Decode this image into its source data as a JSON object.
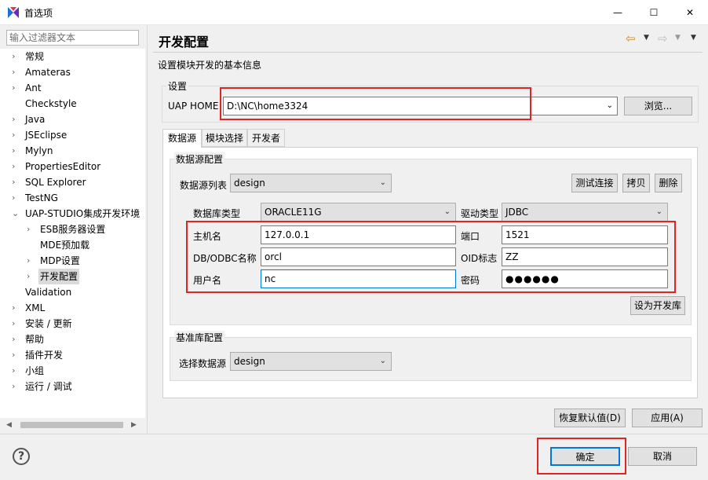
{
  "window": {
    "title": "首选项",
    "minimize": "—",
    "maximize": "☐",
    "close": "✕"
  },
  "filter": {
    "placeholder": "输入过滤器文本"
  },
  "tree": {
    "items": [
      {
        "label": "常规",
        "expandable": true
      },
      {
        "label": "Amateras",
        "expandable": true
      },
      {
        "label": "Ant",
        "expandable": true
      },
      {
        "label": "Checkstyle",
        "expandable": false
      },
      {
        "label": "Java",
        "expandable": true
      },
      {
        "label": "JSEclipse",
        "expandable": true
      },
      {
        "label": "Mylyn",
        "expandable": true
      },
      {
        "label": "PropertiesEditor",
        "expandable": true
      },
      {
        "label": "SQL Explorer",
        "expandable": true
      },
      {
        "label": "TestNG",
        "expandable": true
      },
      {
        "label": "UAP-STUDIO集成开发环境",
        "expanded": true
      },
      {
        "label": "ESB服务器设置",
        "expandable": true
      },
      {
        "label": "MDE预加载",
        "expandable": false
      },
      {
        "label": "MDP设置",
        "expandable": true
      },
      {
        "label": "开发配置",
        "expandable": true,
        "selected": true
      },
      {
        "label": "Validation",
        "expandable": false
      },
      {
        "label": "XML",
        "expandable": true
      },
      {
        "label": "安装 / 更新",
        "expandable": true
      },
      {
        "label": "帮助",
        "expandable": true
      },
      {
        "label": "插件开发",
        "expandable": true
      },
      {
        "label": "小组",
        "expandable": true
      },
      {
        "label": "运行 / 调试",
        "expandable": true
      }
    ]
  },
  "page": {
    "title": "开发配置",
    "description": "设置模块开发的基本信息",
    "settings_group": "设置",
    "uap_home_label": "UAP HOME",
    "uap_home_value": "D:\\NC\\home3324",
    "browse_button": "浏览...",
    "tabs": [
      "数据源",
      "模块选择",
      "开发者"
    ],
    "datasource_group": "数据源配置",
    "ds_list_label": "数据源列表",
    "ds_list_value": "design",
    "test_conn_button": "测试连接",
    "copy_button": "拷贝",
    "delete_button": "删除",
    "db_type_label": "数据库类型",
    "db_type_value": "ORACLE11G",
    "driver_type_label": "驱动类型",
    "driver_type_value": "JDBC",
    "host_label": "主机名",
    "host_value": "127.0.0.1",
    "port_label": "端口",
    "port_value": "1521",
    "dbodbc_label": "DB/ODBC名称",
    "dbodbc_value": "orcl",
    "oid_label": "OID标志",
    "oid_value": "ZZ",
    "user_label": "用户名",
    "user_value": "nc",
    "password_label": "密码",
    "password_value": "●●●●●●",
    "set_dev_db_button": "设为开发库",
    "base_group": "基准库配置",
    "select_ds_label": "选择数据源",
    "select_ds_value": "design",
    "restore_defaults_button": "恢复默认值(D)",
    "apply_button": "应用(A)"
  },
  "footer": {
    "ok_button": "确定",
    "cancel_button": "取消",
    "help_icon": "?"
  },
  "colors": {
    "highlight": "#e02424",
    "focus": "#0078d7",
    "app_icon": "#1e6fd9"
  },
  "icons": {
    "back": "back-arrow-icon",
    "forward": "forward-arrow-icon",
    "menu": "view-menu-icon",
    "help": "help-icon"
  }
}
